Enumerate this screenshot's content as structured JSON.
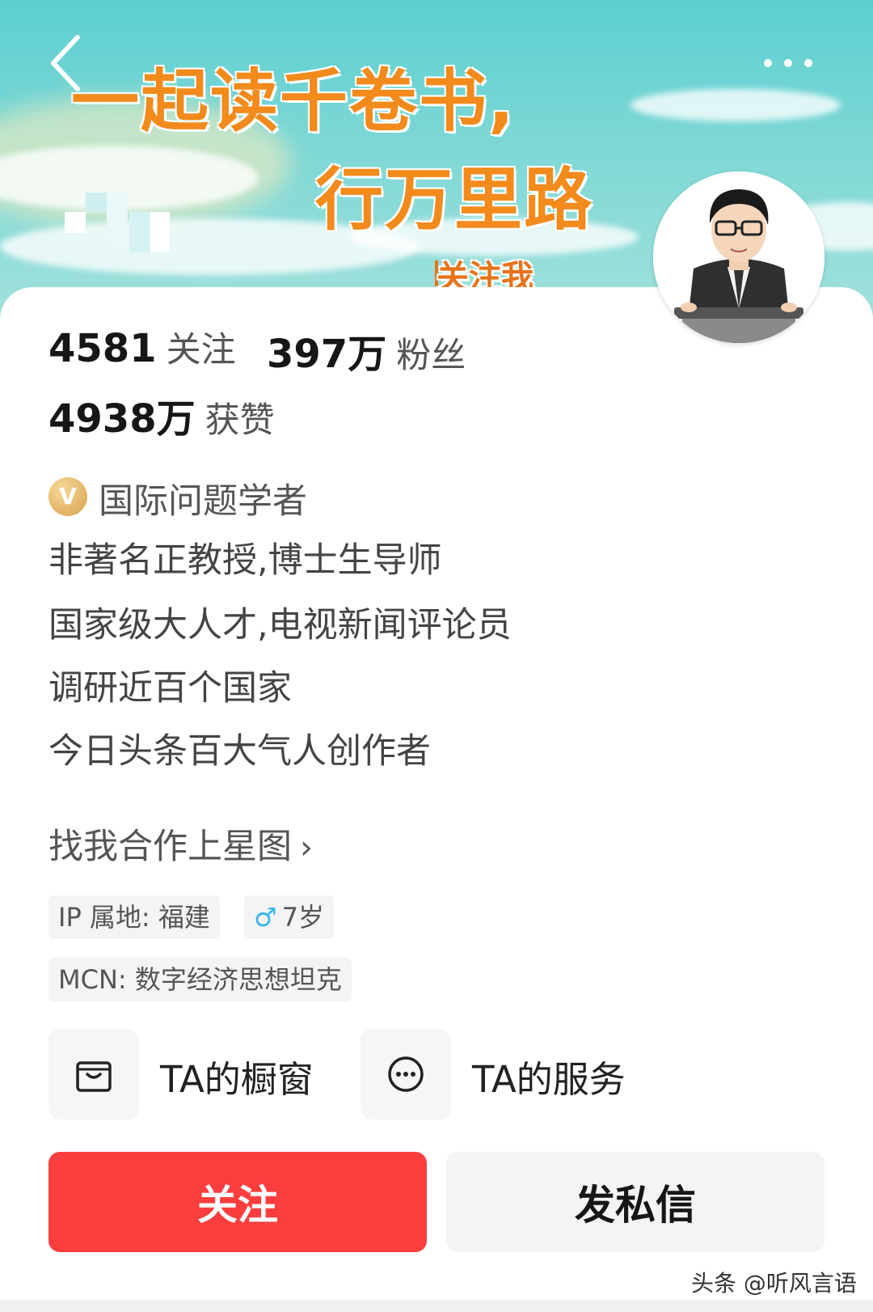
{
  "banner": {
    "line1": "一起读千卷书,",
    "line2": "行万里路",
    "line3": "关注我"
  },
  "header": {
    "back_icon": "chevron-left-icon",
    "more_icon": "more-dots-icon"
  },
  "stats": [
    {
      "value": "4581",
      "label": "关注"
    },
    {
      "value": "397万",
      "label": "粉丝"
    },
    {
      "value": "4938万",
      "label": "获赞"
    }
  ],
  "verification": {
    "badge": "V",
    "title": "国际问题学者"
  },
  "bio": [
    "非著名正教授,博士生导师",
    "国家级大人才,电视新闻评论员",
    "调研近百个国家",
    "今日头条百大气人创作者"
  ],
  "star_link": {
    "label": "找我合作上星图",
    "chevron": "›"
  },
  "tags": {
    "ip": "IP 属地: 福建",
    "gender_symbol": "♂",
    "age": "7岁",
    "mcn": "MCN: 数字经济思想坦克"
  },
  "entries": [
    {
      "icon": "shopping-bag-icon",
      "label": "TA的橱窗"
    },
    {
      "icon": "chat-bubble-icon",
      "label": "TA的服务"
    }
  ],
  "actions": {
    "follow": "关注",
    "message": "发私信"
  },
  "watermark": "头条 @听风言语",
  "colors": {
    "follow_button": "#fa3e3e",
    "banner_text": "#f28a1c",
    "banner_sky": "#5ccfd0",
    "verify_badge": "#d8a14c",
    "gender_icon": "#3ab7ea"
  }
}
